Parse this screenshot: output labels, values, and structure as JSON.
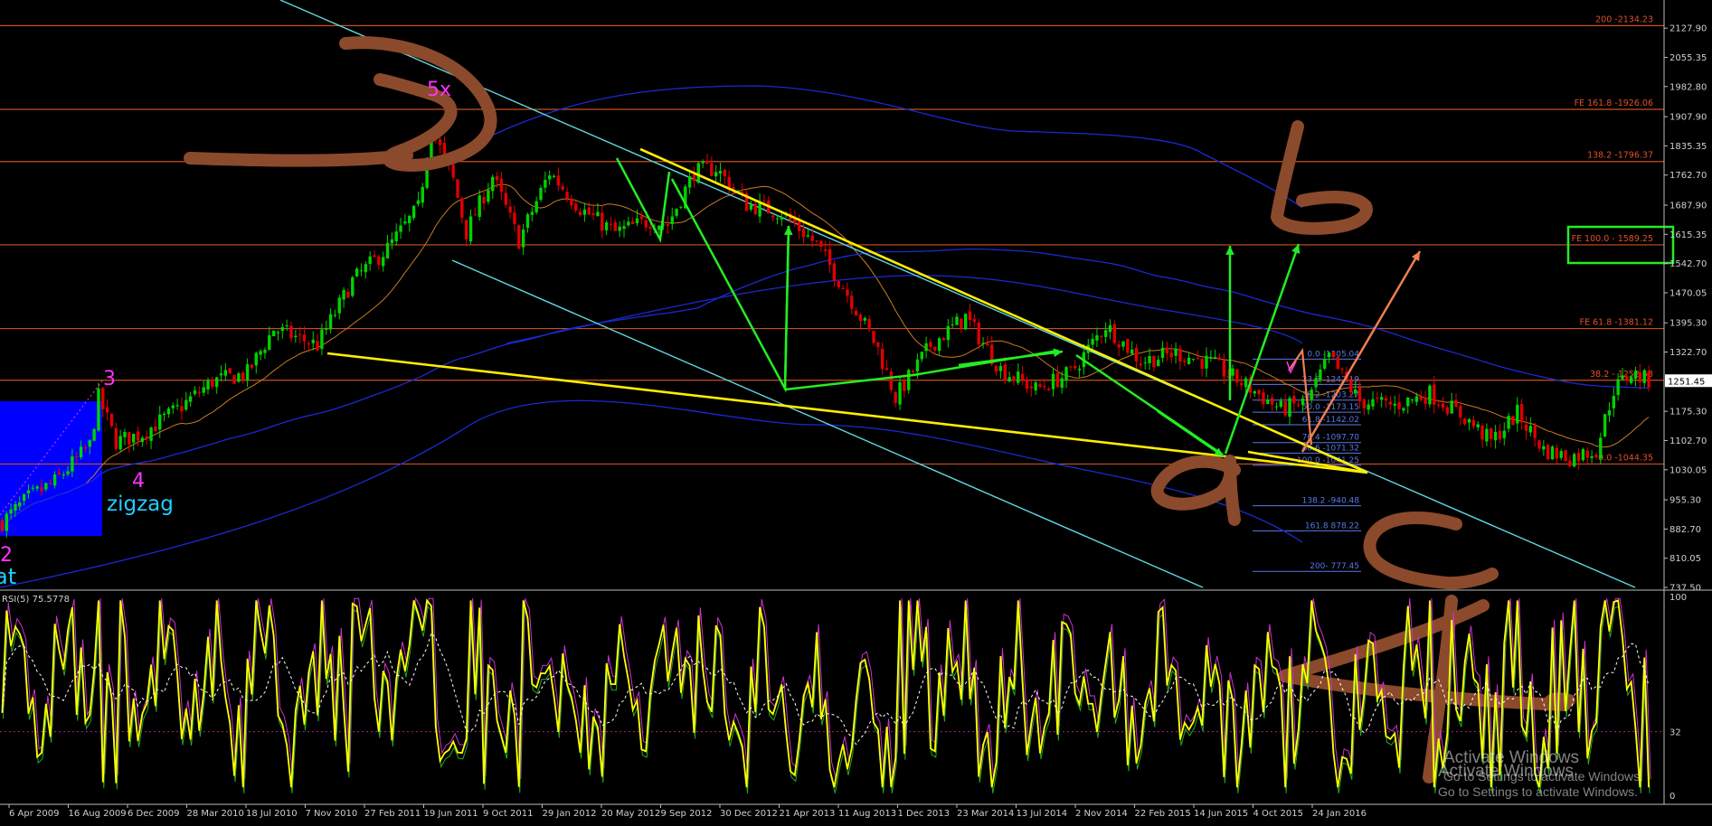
{
  "colors": {
    "background": "#000000",
    "bull_candle": "#00d200",
    "bear_candle": "#e00000",
    "fib_line": "#c8501e",
    "fib_text": "#e0502a",
    "retrace_text": "#5a78e6",
    "channel": "#5fd6e0",
    "trendline": "#ffee00",
    "arrow_green": "#22ee22",
    "arrow_orange": "#f08050",
    "brown": "#8b4a2b",
    "ma_blue": "#1a2ad0",
    "ma_orange": "#c87a20",
    "rsi_line": "#ffff00",
    "wave_magenta": "#ff33ff",
    "wave_cyan": "#22ccff"
  },
  "chart_data": [
    {
      "type": "candlestick",
      "grid": false,
      "ylim": [
        737.5,
        2180
      ],
      "y_ticks": [
        "2127.90",
        "2055.35",
        "1982.80",
        "1907.90",
        "1835.35",
        "1762.70",
        "1687.90",
        "1615.35",
        "1542.70",
        "1470.05",
        "1395.30",
        "1322.70",
        "1175.30",
        "1102.70",
        "1030.05",
        "955.30",
        "882.70",
        "810.05",
        "737.50"
      ],
      "current_price": "1251.45",
      "x_ticks": [
        "6 Apr 2009",
        "16 Aug 2009",
        "6 Dec 2009",
        "28 Mar 2010",
        "18 Jul 2010",
        "7 Nov 2010",
        "27 Feb 2011",
        "19 Jun 2011",
        "9 Oct 2011",
        "29 Jan 2012",
        "20 May 2012",
        "9 Sep 2012",
        "30 Dec 2012",
        "21 Apr 2013",
        "11 Aug 2013",
        "1 Dec 2013",
        "23 Mar 2014",
        "13 Jul 2014",
        "2 Nov 2014",
        "22 Feb 2015",
        "14 Jun 2015",
        "4 Oct 2015",
        "24 Jan 2016"
      ],
      "close_path": [
        {
          "t": 0,
          "p": 900
        },
        {
          "t": 6,
          "p": 960
        },
        {
          "t": 12,
          "p": 1000
        },
        {
          "t": 20,
          "p": 1090
        },
        {
          "t": 22,
          "p": 1210
        },
        {
          "t": 26,
          "p": 1100
        },
        {
          "t": 32,
          "p": 1120
        },
        {
          "t": 40,
          "p": 1180
        },
        {
          "t": 48,
          "p": 1250
        },
        {
          "t": 56,
          "p": 1270
        },
        {
          "t": 62,
          "p": 1380
        },
        {
          "t": 72,
          "p": 1340
        },
        {
          "t": 80,
          "p": 1500
        },
        {
          "t": 88,
          "p": 1580
        },
        {
          "t": 95,
          "p": 1680
        },
        {
          "t": 98,
          "p": 1880
        },
        {
          "t": 103,
          "p": 1750
        },
        {
          "t": 106,
          "p": 1620
        },
        {
          "t": 112,
          "p": 1760
        },
        {
          "t": 118,
          "p": 1600
        },
        {
          "t": 125,
          "p": 1770
        },
        {
          "t": 132,
          "p": 1680
        },
        {
          "t": 140,
          "p": 1620
        },
        {
          "t": 148,
          "p": 1650
        },
        {
          "t": 152,
          "p": 1640
        },
        {
          "t": 158,
          "p": 1770
        },
        {
          "t": 163,
          "p": 1780
        },
        {
          "t": 170,
          "p": 1690
        },
        {
          "t": 178,
          "p": 1670
        },
        {
          "t": 186,
          "p": 1590
        },
        {
          "t": 194,
          "p": 1450
        },
        {
          "t": 200,
          "p": 1330
        },
        {
          "t": 204,
          "p": 1210
        },
        {
          "t": 212,
          "p": 1340
        },
        {
          "t": 220,
          "p": 1410
        },
        {
          "t": 228,
          "p": 1280
        },
        {
          "t": 236,
          "p": 1230
        },
        {
          "t": 244,
          "p": 1270
        },
        {
          "t": 252,
          "p": 1390
        },
        {
          "t": 260,
          "p": 1300
        },
        {
          "t": 268,
          "p": 1320
        },
        {
          "t": 276,
          "p": 1295
        },
        {
          "t": 284,
          "p": 1240
        },
        {
          "t": 292,
          "p": 1180
        },
        {
          "t": 298,
          "p": 1200
        },
        {
          "t": 303,
          "p": 1310
        },
        {
          "t": 310,
          "p": 1200
        },
        {
          "t": 318,
          "p": 1190
        },
        {
          "t": 326,
          "p": 1220
        },
        {
          "t": 334,
          "p": 1160
        },
        {
          "t": 340,
          "p": 1100
        },
        {
          "t": 346,
          "p": 1170
        },
        {
          "t": 352,
          "p": 1080
        },
        {
          "t": 358,
          "p": 1060
        },
        {
          "t": 364,
          "p": 1080
        },
        {
          "t": 368,
          "p": 1230
        },
        {
          "t": 372,
          "p": 1270
        },
        {
          "t": 376,
          "p": 1251
        }
      ],
      "horizontal_levels": [
        {
          "label": "200 -2134.23",
          "price": 2134.23
        },
        {
          "label": "FE 161.8 -1926.06",
          "price": 1926.06
        },
        {
          "label": "138.2 -1796.37",
          "price": 1796.37
        },
        {
          "label": "FE 100.0 - 1589.25",
          "price": 1589.25
        },
        {
          "label": "FE 61.8 -1381.12",
          "price": 1381.12
        },
        {
          "label": "38.2 - 1252.53",
          "price": 1252.53
        },
        {
          "label": "0.0 -1044.35",
          "price": 1044.35
        }
      ],
      "retracement_levels": [
        {
          "label": "0.0 -1305.04",
          "price": 1305.04
        },
        {
          "label": "23.6 -1242.19",
          "price": 1242.19
        },
        {
          "label": "38.2 -1203.27",
          "price": 1203.27
        },
        {
          "label": "50.0 -1173.15",
          "price": 1173.15
        },
        {
          "label": "61.8 -1142.02",
          "price": 1142.02
        },
        {
          "label": "76.4 -1097.70",
          "price": 1097.7
        },
        {
          "label": "88.6 -1071.32",
          "price": 1071.32
        },
        {
          "label": "100.0 -1041.25",
          "price": 1041.25
        },
        {
          "label": "138.2 -940.48",
          "price": 940.48
        },
        {
          "label": "161.8 878.22",
          "price": 878.22
        },
        {
          "label": "200- 777.45",
          "price": 777.45
        }
      ],
      "annotations": [
        "5x",
        "3",
        "4",
        "zigzag",
        "2",
        "at"
      ]
    },
    {
      "type": "line",
      "title": "RSI(5) 75.5778",
      "ylim": [
        0,
        100
      ],
      "y_ticks": [
        "100",
        "32",
        "0"
      ],
      "level": 32
    }
  ],
  "watermark": {
    "line1": "Activate Windows",
    "line2": "Go to Settings to activate Windows."
  }
}
